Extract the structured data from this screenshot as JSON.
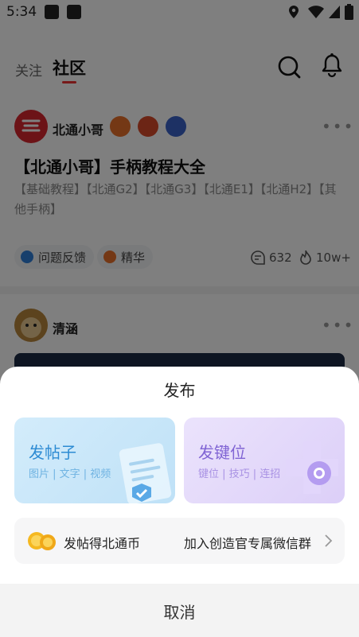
{
  "status_bar": {
    "time": "5:34"
  },
  "tabs": [
    {
      "label": "关注"
    },
    {
      "label": "社区"
    }
  ],
  "posts": [
    {
      "author": "北通小哥",
      "title": "【北通小哥】手柄教程大全",
      "tags": "【基础教程】【北通G2】【北通G3】【北通E1】【北通H2】【其他手柄】",
      "category": "问题反馈",
      "label": "精华",
      "comments": "632",
      "views": "10w+"
    },
    {
      "author": "清涵"
    }
  ],
  "sheet": {
    "title": "发布",
    "post_card": {
      "title": "发帖子",
      "subtitle": "图片 | 文字 | 视频"
    },
    "key_card": {
      "title": "发键位",
      "subtitle": "键位 | 技巧 | 连招"
    },
    "coin_bar": {
      "left_text": "发帖得北通币",
      "right_text": "加入创造官专属微信群"
    },
    "cancel": "取消"
  },
  "colors": {
    "accent_red": "#e33333",
    "post_card_blue": "#3a8fd8",
    "key_card_purple": "#8a6ad8"
  }
}
